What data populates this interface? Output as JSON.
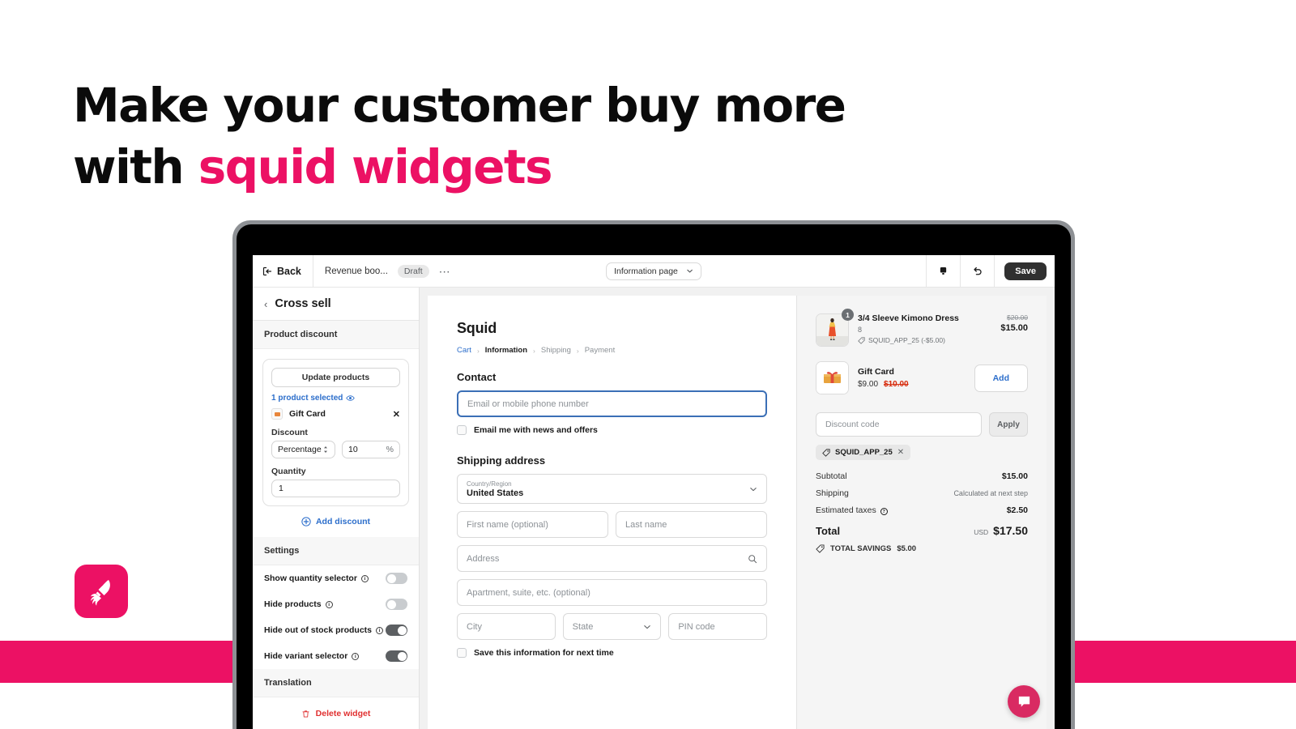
{
  "promo": {
    "headline_line1": "Make your customer buy more",
    "headline_line2_plain": "with ",
    "headline_line2_accent": "squid widgets",
    "accent_color": "#ec1164",
    "logo_icon": "squid-icon"
  },
  "topbar": {
    "back_label": "Back",
    "back_icon": "exit-icon",
    "doc_title": "Revenue boo...",
    "status_badge": "Draft",
    "more_icon": "ellipsis-icon",
    "page_selector": "Information page",
    "page_selector_icon": "chevron-down-icon",
    "preview_icon": "device-preview-icon",
    "undo_icon": "undo-icon",
    "save_label": "Save"
  },
  "sidebar": {
    "back_icon": "chevron-left-icon",
    "title": "Cross sell",
    "product_discount": {
      "section_label": "Product discount",
      "update_products_label": "Update products",
      "selected_label": "1 product selected",
      "selected_icon": "eye-icon",
      "product_name": "Gift Card",
      "product_thumb_icon": "gift-card-icon",
      "remove_icon": "close-icon",
      "discount_label": "Discount",
      "discount_type": "Percentage",
      "discount_type_icon": "select-arrows-icon",
      "discount_value": "10",
      "discount_unit": "%",
      "quantity_label": "Quantity",
      "quantity_value": "1",
      "add_discount_label": "Add discount",
      "add_discount_icon": "plus-circle-icon"
    },
    "settings": {
      "section_label": "Settings",
      "rows": [
        {
          "label": "Show quantity selector",
          "info_icon": "info-icon",
          "on": false
        },
        {
          "label": "Hide products",
          "info_icon": "info-icon",
          "on": false
        },
        {
          "label": "Hide out of stock products",
          "info_icon": "info-icon",
          "on": true
        },
        {
          "label": "Hide variant selector",
          "info_icon": "info-icon",
          "on": true
        }
      ]
    },
    "translation_label": "Translation",
    "delete_label": "Delete widget",
    "delete_icon": "trash-icon"
  },
  "checkout": {
    "brand": "Squid",
    "breadcrumbs": [
      {
        "label": "Cart",
        "state": "link"
      },
      {
        "label": "Information",
        "state": "current"
      },
      {
        "label": "Shipping",
        "state": "dim"
      },
      {
        "label": "Payment",
        "state": "dim"
      }
    ],
    "breadcrumb_sep": "›",
    "contact": {
      "title": "Contact",
      "email_placeholder": "Email or mobile phone number",
      "newsletter_label": "Email me with news and offers",
      "newsletter_checked": false
    },
    "shipping": {
      "title": "Shipping address",
      "country_label": "Country/Region",
      "country_value": "United States",
      "country_icon": "chevron-down-icon",
      "first_name_placeholder": "First name (optional)",
      "last_name_placeholder": "Last name",
      "address_placeholder": "Address",
      "address_icon": "search-icon",
      "apartment_placeholder": "Apartment, suite, etc. (optional)",
      "city_placeholder": "City",
      "state_placeholder": "State",
      "state_icon": "chevron-down-icon",
      "pin_placeholder": "PIN code",
      "save_info_label": "Save this information for next time",
      "save_info_checked": false
    },
    "summary": {
      "items": [
        {
          "name": "3/4 Sleeve Kimono Dress",
          "variant": "8",
          "quantity": "1",
          "discount_tag": "SQUID_APP_25 (-$5.00)",
          "discount_icon": "discount-tag-icon",
          "price_old": "$20.00",
          "price_now": "$15.00",
          "thumb_icon": "dress-photo"
        },
        {
          "name": "Gift Card",
          "price_now": "$9.00",
          "price_old": "$10.00",
          "action_label": "Add",
          "thumb_icon": "gift-card-icon"
        }
      ],
      "discount_placeholder": "Discount code",
      "apply_label": "Apply",
      "applied_code": "SQUID_APP_25",
      "applied_code_icon": "discount-tag-icon",
      "applied_code_remove_icon": "close-icon",
      "lines": [
        {
          "label": "Subtotal",
          "value": "$15.00",
          "dim": false
        },
        {
          "label": "Shipping",
          "value": "Calculated at next step",
          "dim": true
        },
        {
          "label": "Estimated taxes",
          "value": "$2.50",
          "dim": false,
          "info_icon": "info-icon"
        }
      ],
      "total_label": "Total",
      "total_currency": "USD",
      "total_value": "$17.50",
      "savings_label": "TOTAL SAVINGS",
      "savings_value": "$5.00",
      "savings_icon": "discount-tag-icon"
    },
    "chat_icon": "chat-bubble-icon"
  }
}
